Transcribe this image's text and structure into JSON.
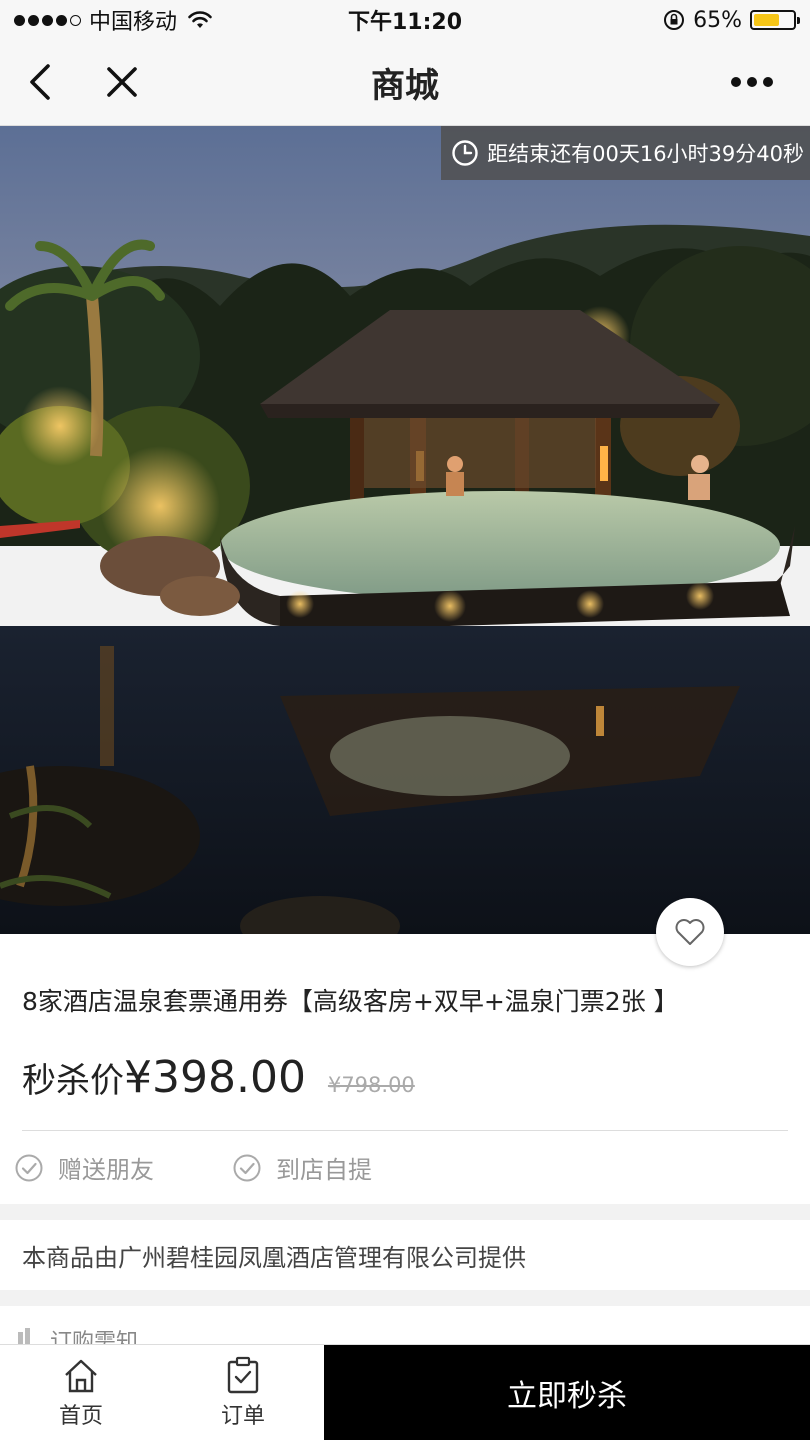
{
  "status_bar": {
    "carrier": "中国移动",
    "time": "下午11:20",
    "battery_percent_label": "65%",
    "battery_level": 0.65,
    "signal_bars_filled": 4,
    "signal_bars_total": 5
  },
  "nav": {
    "title": "商城",
    "icons": [
      "chevron-left-icon",
      "close-icon",
      "more-icon"
    ]
  },
  "hero": {
    "countdown_text": "距结束还有00天16小时39分40秒",
    "countdown_icon": "clock-icon"
  },
  "product": {
    "title": "8家酒店温泉套票通用券【高级客房+双早+温泉门票2张 】",
    "price_label": "秒杀价",
    "price": "¥398.00",
    "original_price": "¥798.00",
    "features": [
      {
        "label": "赠送朋友",
        "icon": "check-circle-icon"
      },
      {
        "label": "到店自提",
        "icon": "check-circle-icon"
      }
    ]
  },
  "provider_text": "本商品由广州碧桂园凤凰酒店管理有限公司提供",
  "notice_label": "订购需知",
  "bottom_bar": {
    "tabs": [
      {
        "label": "首页",
        "icon": "home-icon"
      },
      {
        "label": "订单",
        "icon": "order-clipboard-icon"
      }
    ],
    "buy_label": "立即秒杀"
  },
  "colors": {
    "buy_button_bg": "#000000",
    "battery_fill": "#f5c518",
    "countdown_bg": "#505050"
  }
}
